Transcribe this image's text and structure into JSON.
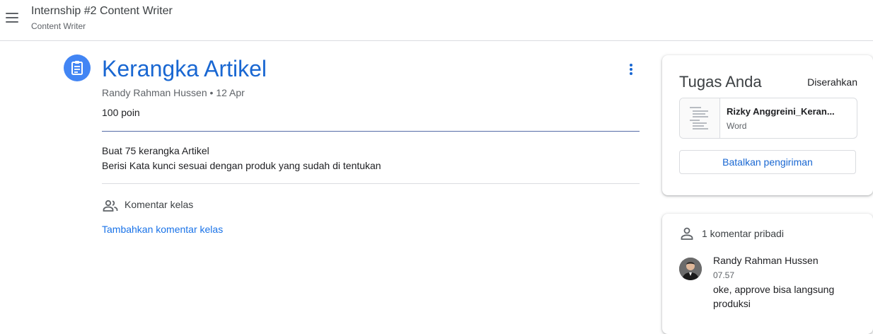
{
  "header": {
    "menu_icon": "hamburger-menu-icon",
    "title": "Internship #2 Content Writer",
    "subtitle": "Content Writer"
  },
  "assignment": {
    "icon": "assignment-icon",
    "title": "Kerangka Artikel",
    "meta": "Randy Rahman Hussen • 12 Apr",
    "points": "100 poin",
    "description_line1": "Buat 75 kerangka Artikel",
    "description_line2": "Berisi Kata kunci sesuai dengan produk yang sudah di tentukan",
    "more_icon": "more-vertical-icon",
    "accent_color": "#1967d2"
  },
  "class_comments": {
    "icon": "people-icon",
    "label": "Komentar kelas",
    "add_link": "Tambahkan komentar kelas"
  },
  "your_work": {
    "title": "Tugas Anda",
    "status": "Diserahkan",
    "attachment": {
      "name": "Rizky Anggreini_Keran...",
      "type": "Word"
    },
    "unsubmit_label": "Batalkan pengiriman"
  },
  "private_comments": {
    "icon": "person-icon",
    "count_label": "1 komentar pribadi",
    "comments": [
      {
        "author": "Randy Rahman Hussen",
        "time": "07.57",
        "text": "oke, approve bisa langsung produksi"
      }
    ]
  }
}
